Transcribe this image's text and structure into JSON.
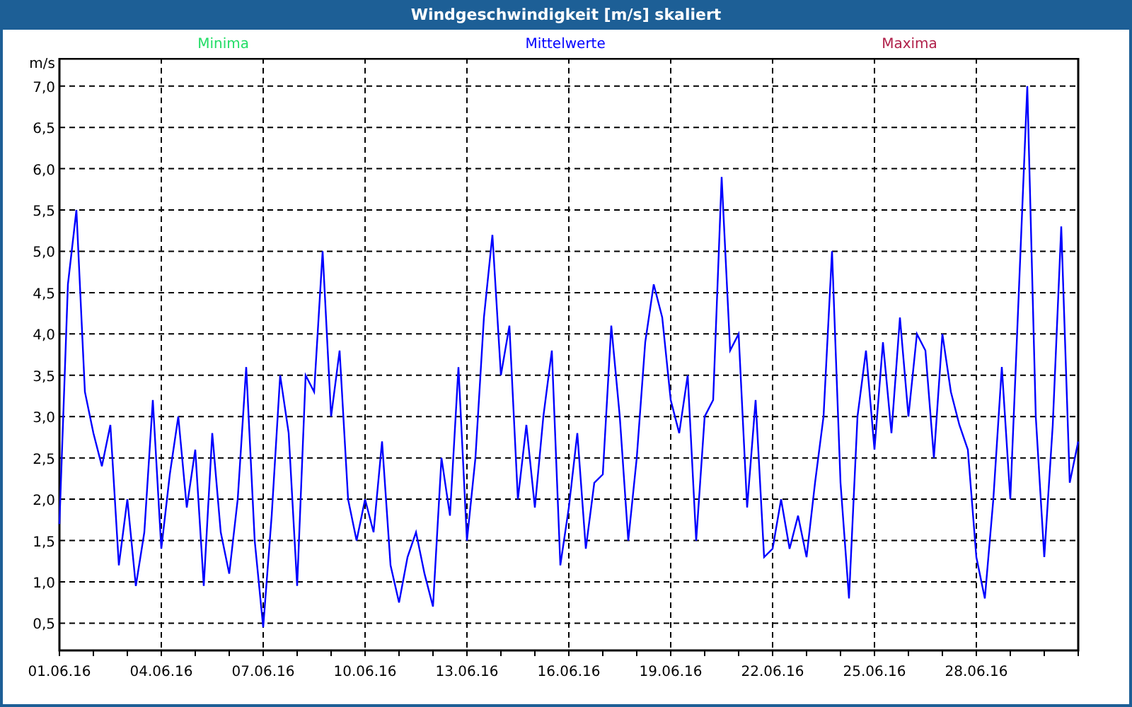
{
  "window": {
    "title": "Windgeschwindigkeit [m/s] skaliert"
  },
  "chart": {
    "legend": [
      {
        "label": "Minima",
        "color": "#22dd66"
      },
      {
        "label": "Maxima",
        "color": "#b0204a"
      }
    ],
    "chart_data": {
      "type": "line",
      "ylabel": "m/s",
      "grid": true,
      "ylim": [
        0.17,
        7.34
      ],
      "yticks": [
        {
          "value": 0.5,
          "label": "0,5"
        },
        {
          "value": 1,
          "label": "1,0"
        },
        {
          "value": 1.5,
          "label": "1,5"
        },
        {
          "value": 2,
          "label": "2,0"
        },
        {
          "value": 2.5,
          "label": "2,5"
        },
        {
          "value": 3,
          "label": "3,0"
        },
        {
          "value": 3.5,
          "label": "3,5"
        },
        {
          "value": 4,
          "label": "4,0"
        },
        {
          "value": 4.5,
          "label": "4,5"
        },
        {
          "value": 5,
          "label": "5,0"
        },
        {
          "value": 5.5,
          "label": "5,5"
        },
        {
          "value": 6,
          "label": "6,0"
        },
        {
          "value": 6.5,
          "label": "6,5"
        },
        {
          "value": 7,
          "label": "7,0"
        }
      ],
      "categories": [
        "01.06.16",
        null,
        null,
        null,
        null,
        null,
        null,
        null,
        null,
        null,
        null,
        null,
        "04.06.16",
        null,
        null,
        null,
        null,
        null,
        null,
        null,
        null,
        null,
        null,
        null,
        "07.06.16",
        null,
        null,
        null,
        null,
        null,
        null,
        null,
        null,
        null,
        null,
        null,
        "10.06.16",
        null,
        null,
        null,
        null,
        null,
        null,
        null,
        null,
        null,
        null,
        null,
        "13.06.16",
        null,
        null,
        null,
        null,
        null,
        null,
        null,
        null,
        null,
        null,
        null,
        "16.06.16",
        null,
        null,
        null,
        null,
        null,
        null,
        null,
        null,
        null,
        null,
        null,
        "19.06.16",
        null,
        null,
        null,
        null,
        null,
        null,
        null,
        null,
        null,
        null,
        null,
        "22.06.16",
        null,
        null,
        null,
        null,
        null,
        null,
        null,
        null,
        null,
        null,
        null,
        "25.06.16",
        null,
        null,
        null,
        null,
        null,
        null,
        null,
        null,
        null,
        null,
        null,
        "28.06.16",
        null,
        null,
        null,
        null,
        null,
        null,
        null,
        null,
        null,
        null,
        null,
        null
      ],
      "series": [
        {
          "name": "Mittelwerte",
          "color": "#0000ff",
          "values": [
            1.7,
            4.6,
            5.5,
            3.3,
            2.8,
            2.4,
            2.9,
            1.2,
            2.0,
            0.95,
            1.6,
            3.2,
            1.4,
            2.3,
            3.0,
            1.9,
            2.6,
            0.95,
            2.8,
            1.6,
            1.1,
            2.0,
            3.6,
            1.5,
            0.45,
            1.8,
            3.5,
            2.8,
            0.95,
            3.5,
            3.3,
            5.0,
            3.0,
            3.8,
            2.0,
            1.5,
            2.0,
            1.6,
            2.7,
            1.2,
            0.75,
            1.3,
            1.6,
            1.1,
            0.7,
            2.5,
            1.8,
            3.6,
            1.5,
            2.5,
            4.2,
            5.2,
            3.5,
            4.1,
            2.0,
            2.9,
            1.9,
            3.0,
            3.8,
            1.2,
            1.9,
            2.8,
            1.4,
            2.2,
            2.3,
            4.1,
            3.0,
            1.5,
            2.5,
            3.9,
            4.6,
            4.2,
            3.2,
            2.8,
            3.5,
            1.5,
            3.0,
            3.2,
            5.9,
            3.8,
            4.0,
            1.9,
            3.2,
            1.3,
            1.4,
            2.0,
            1.4,
            1.8,
            1.3,
            2.2,
            3.0,
            5.0,
            2.2,
            0.8,
            3.0,
            3.8,
            2.6,
            3.9,
            2.8,
            4.2,
            3.0,
            4.0,
            3.8,
            2.5,
            4.0,
            3.3,
            2.9,
            2.6,
            1.3,
            0.8,
            2.0,
            3.6,
            2.0,
            4.5,
            7.0,
            3.0,
            1.3,
            2.9,
            5.3,
            2.2,
            2.7
          ]
        }
      ]
    }
  }
}
